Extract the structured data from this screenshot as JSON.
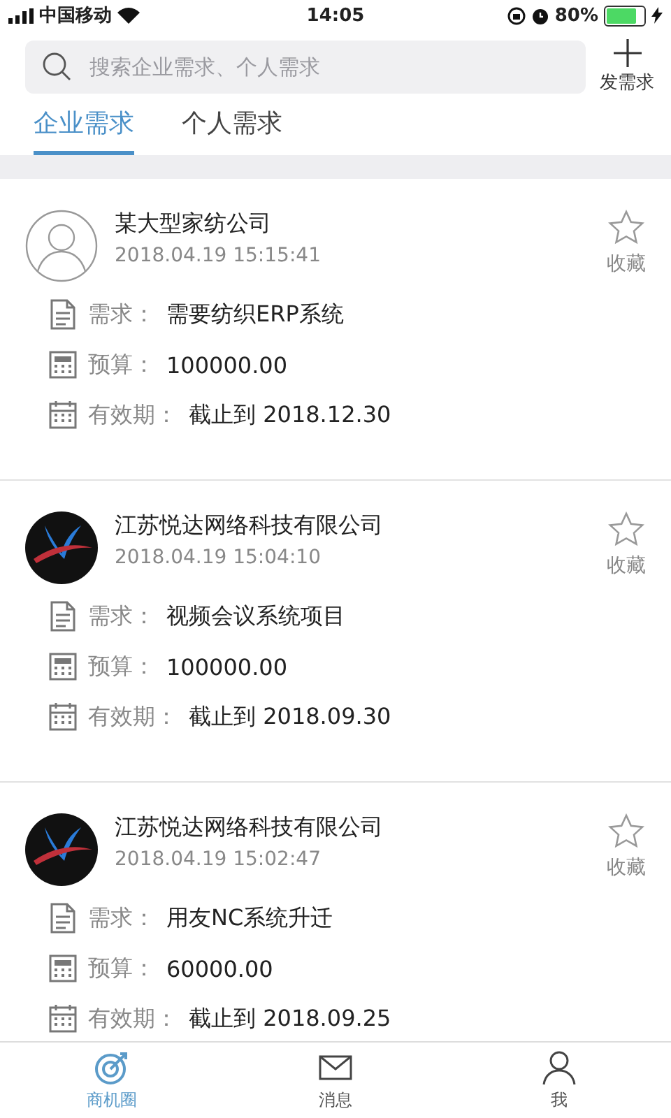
{
  "status_bar": {
    "carrier": "中国移动",
    "time": "14:05",
    "battery": "80%"
  },
  "search": {
    "placeholder": "搜索企业需求、个人需求"
  },
  "post_button": {
    "label": "发需求"
  },
  "tabs": [
    {
      "label": "企业需求",
      "selected": true
    },
    {
      "label": "个人需求",
      "selected": false
    }
  ],
  "posts": [
    {
      "avatar": {
        "kind": "default"
      },
      "company": "某大型家纺公司",
      "date": "2018.04.19 15:15:41",
      "favorite_label": "收藏",
      "favorited": false,
      "rows": [
        {
          "kind": "requirement",
          "label": "需求：",
          "value": "需要纺织ERP系统"
        },
        {
          "kind": "budget",
          "label": "预算：",
          "value": "100000.00"
        },
        {
          "kind": "validity",
          "label": "有效期：",
          "value": "截止到 2018.12.30"
        }
      ]
    },
    {
      "avatar": {
        "kind": "logo"
      },
      "company": "江苏悦达网络科技有限公司",
      "date": "2018.04.19 15:04:10",
      "favorite_label": "收藏",
      "favorited": false,
      "rows": [
        {
          "kind": "requirement",
          "label": "需求：",
          "value": "视频会议系统项目"
        },
        {
          "kind": "budget",
          "label": "预算：",
          "value": "100000.00"
        },
        {
          "kind": "validity",
          "label": "有效期：",
          "value": "截止到 2018.09.30"
        }
      ]
    },
    {
      "avatar": {
        "kind": "logo"
      },
      "company": "江苏悦达网络科技有限公司",
      "date": "2018.04.19 15:02:47",
      "favorite_label": "收藏",
      "favorited": false,
      "rows": [
        {
          "kind": "requirement",
          "label": "需求：",
          "value": "用友NC系统升迁"
        },
        {
          "kind": "budget",
          "label": "预算：",
          "value": "60000.00"
        },
        {
          "kind": "validity",
          "label": "有效期：",
          "value": "截止到 2018.09.25"
        }
      ]
    }
  ],
  "tab_bar": [
    {
      "kind": "opportunities",
      "label": "商机圈",
      "selected": true
    },
    {
      "kind": "messages",
      "label": "消息",
      "selected": false
    },
    {
      "kind": "me",
      "label": "我",
      "selected": false
    }
  ]
}
